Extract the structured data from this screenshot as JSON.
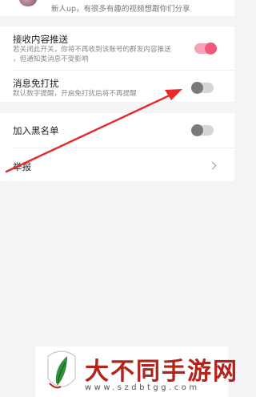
{
  "header": {
    "profile_desc": "新人up，有很多有趣的视频想跟你们分享"
  },
  "settings": {
    "receive_push": {
      "title": "接收内容推送",
      "desc_line1": "若关闭此开关，你将不再收到该账号的群发内容推送",
      "desc_line2": "，但通知类消息不受影响",
      "state": "on"
    },
    "do_not_disturb": {
      "title": "消息免打扰",
      "desc": "默认数字提醒，开启免打扰后将不再提醒",
      "state": "off"
    },
    "blacklist": {
      "title": "加入黑名单",
      "state": "off"
    },
    "report": {
      "title": "举报"
    }
  },
  "colors": {
    "toggle_on": "#f0587e",
    "toggle_off": "#7a7a7a",
    "annotation_arrow": "#e8282b",
    "watermark_text": "#b5221b"
  },
  "watermark": {
    "title": "大不同手游网",
    "url": "www.szdbtgg.com"
  }
}
